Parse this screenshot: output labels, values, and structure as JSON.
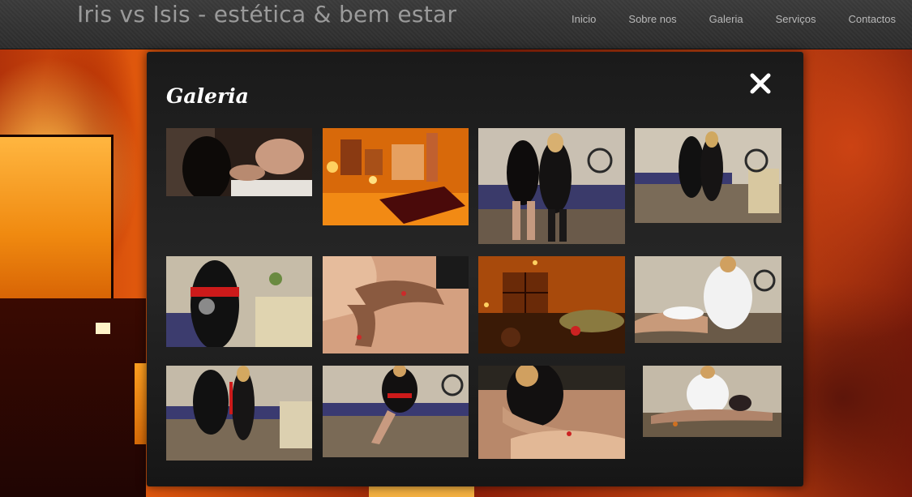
{
  "site": {
    "title": "Iris vs Isis - estética & bem estar"
  },
  "nav": {
    "items": [
      {
        "label": "Inicio"
      },
      {
        "label": "Sobre nos"
      },
      {
        "label": "Galeria"
      },
      {
        "label": "Serviços"
      },
      {
        "label": "Contactos"
      }
    ]
  },
  "modal": {
    "title": "Galeria",
    "close_icon": "close-icon"
  },
  "gallery": {
    "thumbnails": [
      {
        "subject": "massage-feet-photo"
      },
      {
        "subject": "candles-products-photo"
      },
      {
        "subject": "two-women-standing-photo"
      },
      {
        "subject": "two-women-room-photo"
      },
      {
        "subject": "woman-red-belt-photo"
      },
      {
        "subject": "back-massage-photo"
      },
      {
        "subject": "candlelit-room-photo"
      },
      {
        "subject": "white-uniform-massage-photo"
      },
      {
        "subject": "two-women-table-photo"
      },
      {
        "subject": "woman-seated-table-photo"
      },
      {
        "subject": "leg-massage-photo"
      },
      {
        "subject": "massage-table-white-photo"
      }
    ]
  },
  "colors": {
    "topbar": "#2f2f2f",
    "modal": "#1e1e1e",
    "accent_orange": "#e0580d"
  }
}
